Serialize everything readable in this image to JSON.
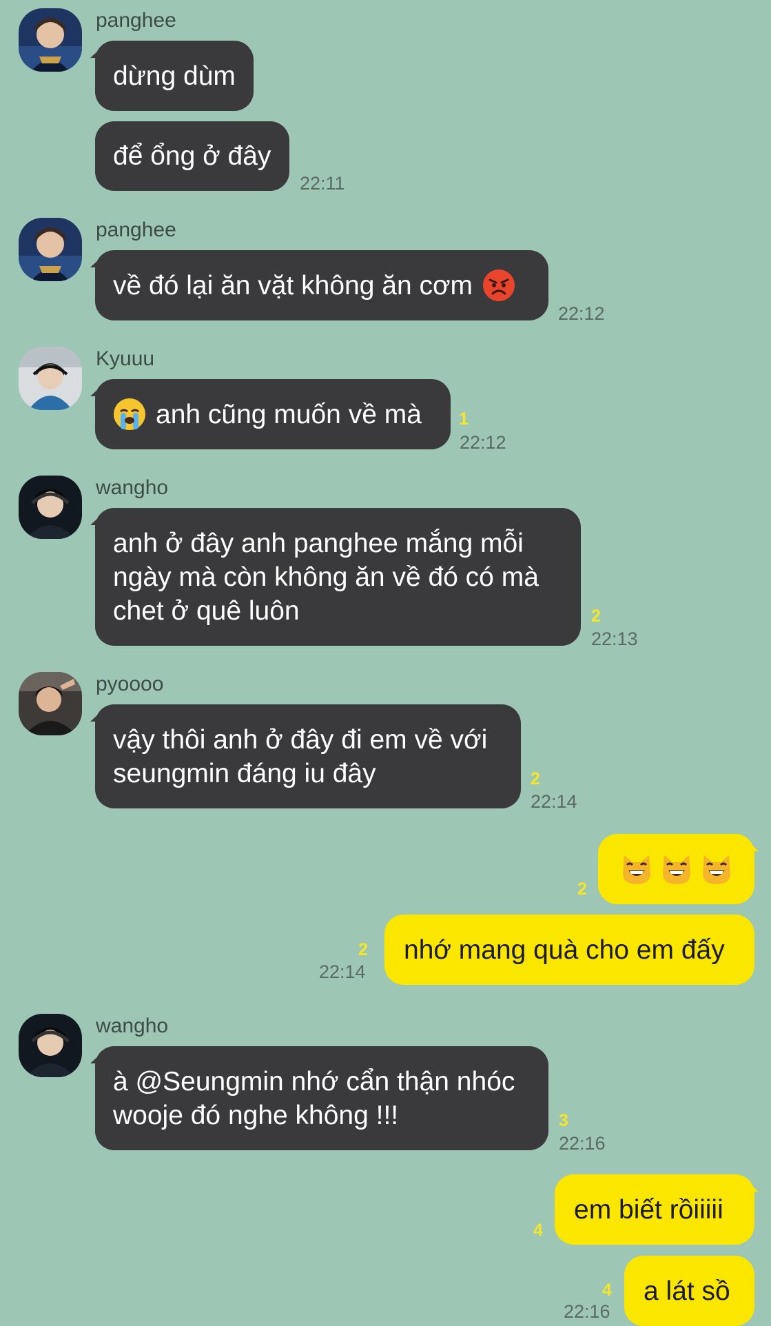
{
  "colors": {
    "background": "#9dc6b4",
    "incoming_bubble": "#3a3a3c",
    "outgoing_bubble": "#fbe600",
    "unread_count": "#f6e62a"
  },
  "messages": {
    "m1": {
      "sender": "panghee",
      "text": "dừng dùm"
    },
    "m2": {
      "text": "để ổng ở đây",
      "time": "22:11"
    },
    "m3": {
      "sender": "panghee",
      "text": "về đó lại ăn vặt không ăn cơm",
      "emoji": "angry-face-icon",
      "time": "22:12"
    },
    "m4": {
      "sender": "Kyuuu",
      "emoji": "loudly-crying-face-icon",
      "text": "anh cũng muốn về mà",
      "unread": "1",
      "time": "22:12"
    },
    "m5": {
      "sender": "wangho",
      "text": "anh ở đây anh panghee mắng mỗi\nngày mà còn không ăn về đó có mà\nchet ở quê luôn",
      "unread": "2",
      "time": "22:13"
    },
    "m6": {
      "sender": "pyoooo",
      "text": "vậy thôi anh ở đây đi em về với\nseungmin đáng iu đây",
      "unread": "2",
      "time": "22:14"
    },
    "m7": {
      "emoji": "grinning-cat-icon x3",
      "unread": "2"
    },
    "m8": {
      "text": "nhớ mang quà cho em đấy",
      "unread": "2",
      "time": "22:14"
    },
    "m9": {
      "sender": "wangho",
      "text": "à @Seungmin nhớ cẩn thận nhóc\nwooje đó nghe không !!!",
      "unread": "3",
      "time": "22:16"
    },
    "m10": {
      "text": "em biết rồiiiii",
      "unread": "4"
    },
    "m11": {
      "text": "a lát sồ",
      "unread": "4",
      "time": "22:16"
    }
  }
}
